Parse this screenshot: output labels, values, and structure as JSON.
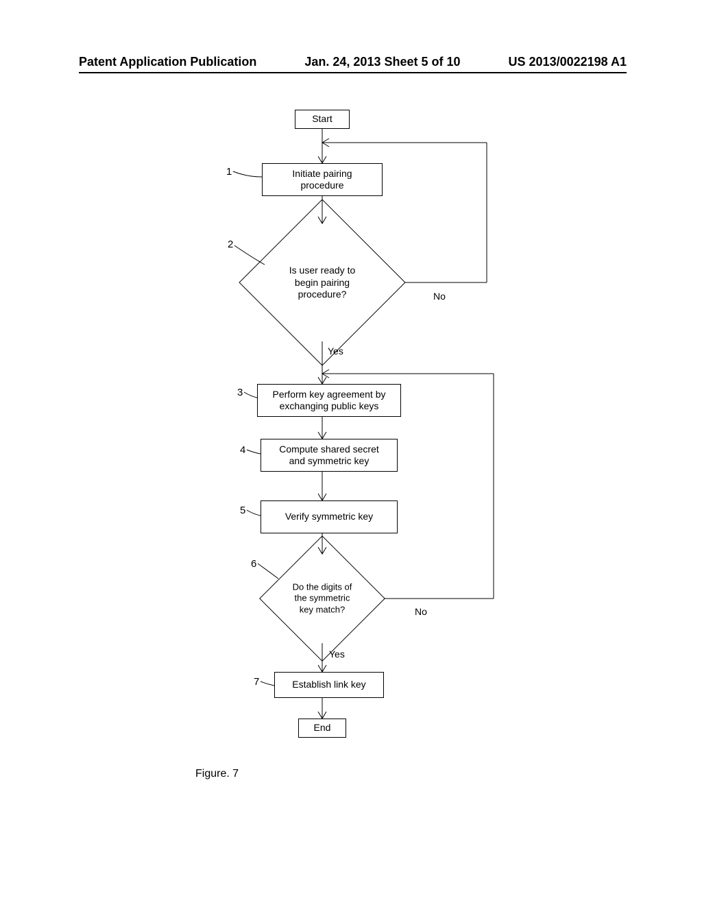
{
  "header": {
    "left": "Patent Application Publication",
    "center": "Jan. 24, 2013  Sheet 5 of 10",
    "right": "US 2013/0022198 A1"
  },
  "flow": {
    "start": "Start",
    "step1_label": "1",
    "step1_text": "Initiate pairing\nprocedure",
    "step2_label": "2",
    "step2_text": "Is user ready to\nbegin pairing\nprocedure?",
    "step2_yes": "Yes",
    "step2_no": "No",
    "step3_label": "3",
    "step3_text": "Perform key agreement by\nexchanging public keys",
    "step4_label": "4",
    "step4_text": "Compute shared secret\nand symmetric key",
    "step5_label": "5",
    "step5_text": "Verify symmetric key",
    "step6_label": "6",
    "step6_text": "Do the digits of\nthe symmetric\nkey match?",
    "step6_yes": "Yes",
    "step6_no": "No",
    "step7_label": "7",
    "step7_text": "Establish link key",
    "end": "End"
  },
  "figure": {
    "label": "Figure.  7"
  }
}
